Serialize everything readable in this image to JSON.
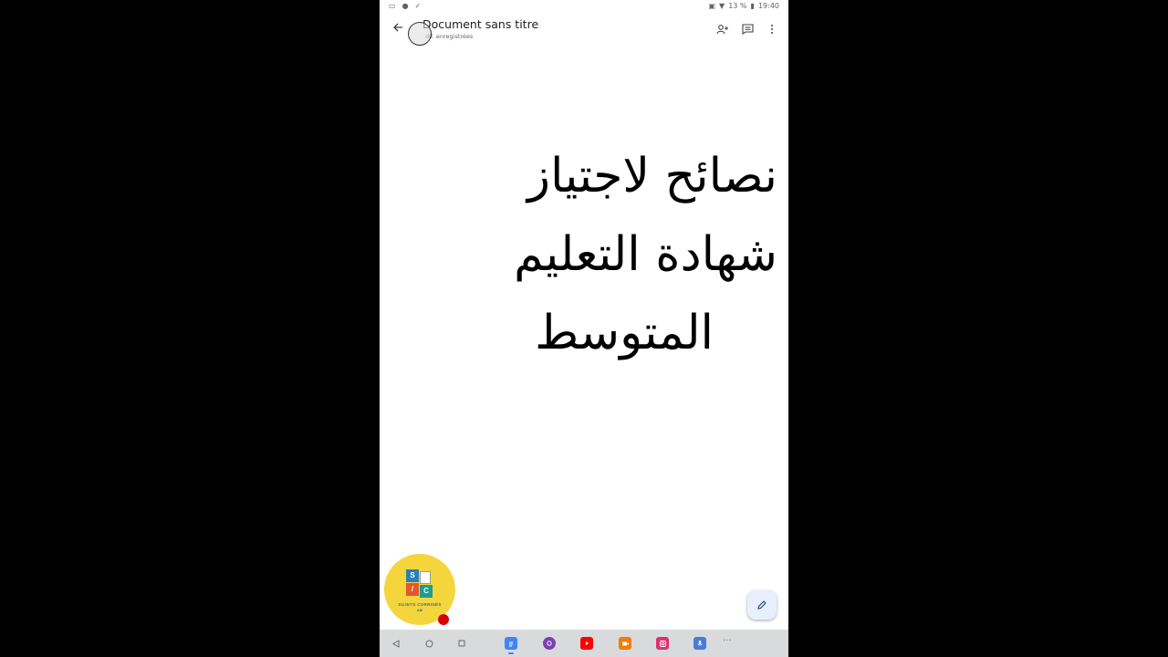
{
  "status_bar": {
    "battery": "13 %",
    "time": "19:40"
  },
  "app_bar": {
    "title": "Document sans titre",
    "save_status": "Modif. enregistrées",
    "save_status_visible": "dif. enregistrées"
  },
  "document": {
    "lines": [
      "نصائح لاجتياز",
      "شهادة التعليم",
      "المتوسط"
    ]
  },
  "logo": {
    "tile_s": "S",
    "tile_c": "C",
    "caption": "SUJETS CORRIGÉS",
    "caption_2": "AM"
  },
  "icons": {
    "back": "arrow-left-icon",
    "share": "person-add-icon",
    "comment": "comment-icon",
    "more": "more-vert-icon",
    "edit": "pencil-icon"
  },
  "colors": {
    "accent": "#4285f4",
    "fab_bg": "#e8f0fe",
    "logo_bg": "#f5d53c",
    "record": "#d50000"
  }
}
